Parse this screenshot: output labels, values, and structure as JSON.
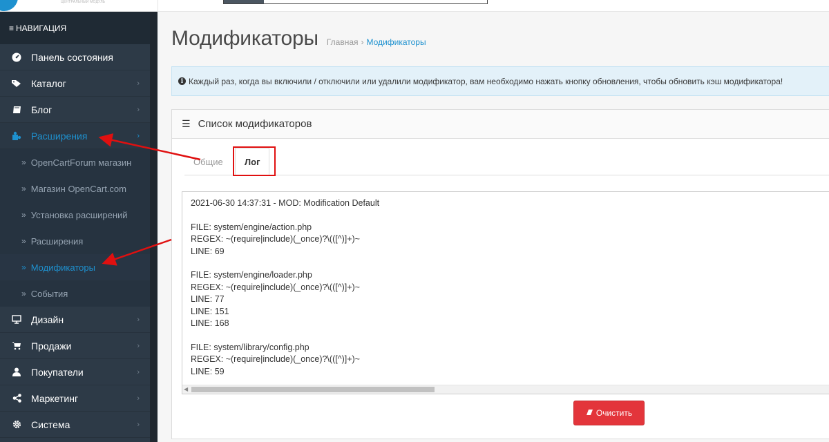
{
  "header": {
    "logo_sub": "ЦЕНТРАЛЬНЫЙ МОДУЛЬ"
  },
  "sidebar": {
    "nav_title": "НАВИГАЦИЯ",
    "items": [
      {
        "label": "Панель состояния",
        "icon": "dashboard-icon",
        "chevron": false
      },
      {
        "label": "Каталог",
        "icon": "tag-icon",
        "chevron": true
      },
      {
        "label": "Блог",
        "icon": "book-icon",
        "chevron": true
      },
      {
        "label": "Расширения",
        "icon": "puzzle-icon",
        "chevron": true,
        "active": true
      },
      {
        "label": "Дизайн",
        "icon": "monitor-icon",
        "chevron": true
      },
      {
        "label": "Продажи",
        "icon": "cart-icon",
        "chevron": true
      },
      {
        "label": "Покупатели",
        "icon": "user-icon",
        "chevron": true
      },
      {
        "label": "Маркетинг",
        "icon": "share-icon",
        "chevron": true
      },
      {
        "label": "Система",
        "icon": "gear-icon",
        "chevron": true
      }
    ],
    "sub_items": [
      {
        "label": "OpenCartForum магазин"
      },
      {
        "label": "Магазин OpenCart.com"
      },
      {
        "label": "Установка расширений"
      },
      {
        "label": "Расширения"
      },
      {
        "label": "Модификаторы",
        "current": true
      },
      {
        "label": "События"
      }
    ]
  },
  "page": {
    "title": "Модификаторы",
    "breadcrumb": [
      "Главная",
      "Модификаторы"
    ],
    "breadcrumb_sep": "›",
    "alert": "Каждый раз, когда вы включили / отключили или удалили модификатор, вам необходимо нажать кнопку обновления, чтобы обновить кэш модификатора!"
  },
  "panel": {
    "heading": "Список модификаторов",
    "tabs": [
      "Общие",
      "Лог"
    ],
    "active_tab": "Лог",
    "log_text": "2021-06-30 14:37:31 - MOD: Modification Default\n\nFILE: system/engine/action.php\nREGEX: ~(require|include)(_once)?\\(([^)]+)~\nLINE: 69\n\nFILE: system/engine/loader.php\nREGEX: ~(require|include)(_once)?\\(([^)]+)~\nLINE: 77\nLINE: 151\nLINE: 168\n\nFILE: system/library/config.php\nREGEX: ~(require|include)(_once)?\\(([^)]+)~\nLINE: 59",
    "clear_button": "Очистить"
  },
  "colors": {
    "sidebar_bg": "#2d3a47",
    "accent": "#1e91cf",
    "danger": "#e3353b",
    "annotation": "#e01010"
  }
}
